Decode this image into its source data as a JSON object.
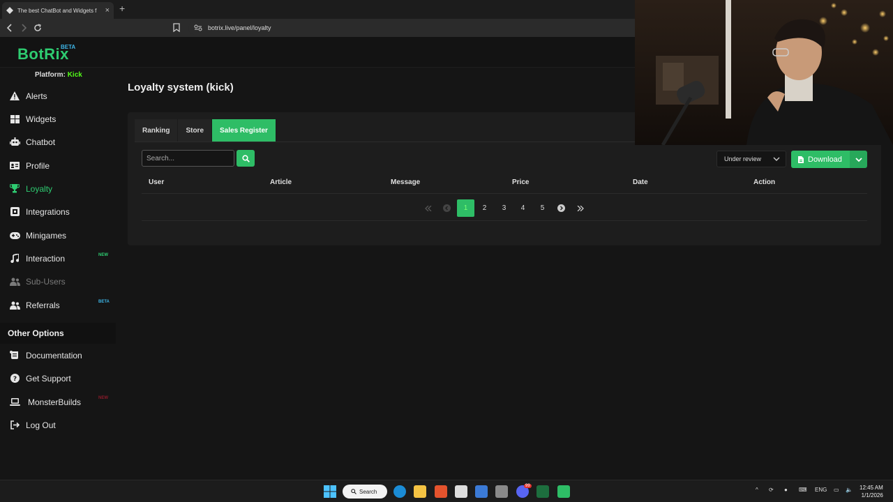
{
  "browser": {
    "tab_title": "The best ChatBot and Widgets f",
    "url": "botrix.live/panel/loyalty"
  },
  "app": {
    "logo": "BotRix",
    "logo_badge": "BETA",
    "platform_label": "Platform:",
    "platform_value": "Kick"
  },
  "sidebar": {
    "items": [
      {
        "label": "Alerts"
      },
      {
        "label": "Widgets"
      },
      {
        "label": "Chatbot"
      },
      {
        "label": "Profile"
      },
      {
        "label": "Loyalty"
      },
      {
        "label": "Integrations"
      },
      {
        "label": "Minigames"
      },
      {
        "label": "Interaction",
        "badge": "NEW"
      },
      {
        "label": "Sub-Users"
      },
      {
        "label": "Referrals",
        "badge": "BETA"
      }
    ],
    "section_title": "Other Options",
    "other_items": [
      {
        "label": "Documentation"
      },
      {
        "label": "Get Support"
      },
      {
        "label": "MonsterBuilds",
        "badge": "NEW"
      },
      {
        "label": "Log Out"
      }
    ]
  },
  "main": {
    "title": "Loyalty system (kick)",
    "tabs": [
      {
        "label": "Ranking"
      },
      {
        "label": "Store"
      },
      {
        "label": "Sales Register"
      }
    ],
    "search_placeholder": "Search...",
    "status_filter": "Under review",
    "download_label": "Download",
    "columns": [
      "User",
      "Article",
      "Message",
      "Price",
      "Date",
      "Action"
    ],
    "pages": [
      "1",
      "2",
      "3",
      "4",
      "5"
    ]
  },
  "taskbar": {
    "search_label": "Search",
    "discord_badge": "99",
    "lang": "ENG",
    "time": "12:45 AM",
    "date": "1/1/2026"
  },
  "colors": {
    "accent": "#2ebd66",
    "brand_green": "#2ecc71",
    "kick_green": "#53fc18",
    "background": "#151515"
  }
}
